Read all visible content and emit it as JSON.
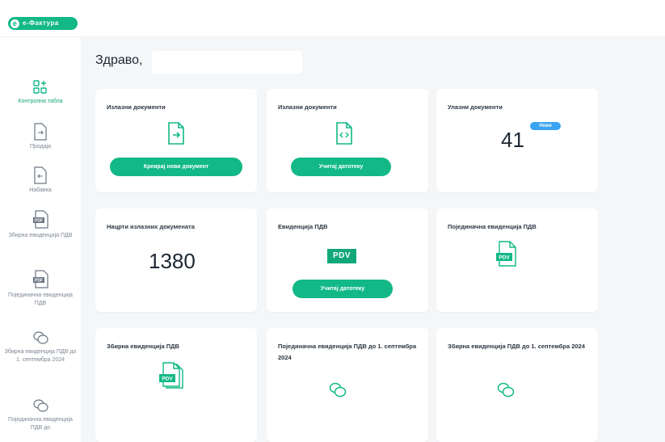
{
  "app": {
    "logo_text": "e-Фактура",
    "colors": {
      "accent": "#12b886",
      "badge": "#3aa3f2",
      "background": "#f4f6f8"
    }
  },
  "sidebar": {
    "items": [
      {
        "label": "Контролна табла",
        "icon": "dashboard-icon",
        "active": true
      },
      {
        "label": "Продаја",
        "icon": "sales-document-icon"
      },
      {
        "label": "Набавка",
        "icon": "purchase-document-icon"
      },
      {
        "label": "Збирна евиденција ПДВ",
        "icon": "pdf-document-icon"
      },
      {
        "label": "Појединачна евиденција ПДВ",
        "icon": "pdf-document-icon"
      },
      {
        "label": "Збирна евиденција ПДВ до 1. септембра 2024",
        "icon": "chat-bubbles-icon"
      },
      {
        "label": "Појединачна евиденција ПДВ до",
        "icon": "chat-bubbles-icon"
      }
    ]
  },
  "main": {
    "greeting": "Здраво,",
    "cards": {
      "outgoing": {
        "title": "Излазни документи",
        "icon": "outgoing-document-icon",
        "button": "Креирај нови документ"
      },
      "import": {
        "title": "Излазни документи",
        "icon": "xml-file-icon",
        "button": "Учитај датотеку"
      },
      "incoming": {
        "title": "Улазни документи",
        "count": "41",
        "badge": "Нови"
      },
      "rejected": {
        "title": "Нацрти излазних докумената",
        "count": "1380"
      },
      "vat_records": {
        "title": "Евиденција ПДВ",
        "pdv_label": "PDV",
        "button": "Учитај датотеку"
      },
      "individual_vat": {
        "title": "Појединачна евиденција ПДВ",
        "pdv_label": "PDV"
      },
      "summary_vat": {
        "title": "Збирна евиденција ПДВ",
        "pdv_label": "PDV"
      },
      "individual_vat_old": {
        "title": "Појединачна евиденција ПДВ до 1. септембра 2024",
        "icon": "chat-bubbles-icon"
      },
      "summary_vat_old": {
        "title": "Збирна евиденција ПДВ до 1. септембра 2024",
        "icon": "chat-bubbles-icon"
      }
    }
  }
}
